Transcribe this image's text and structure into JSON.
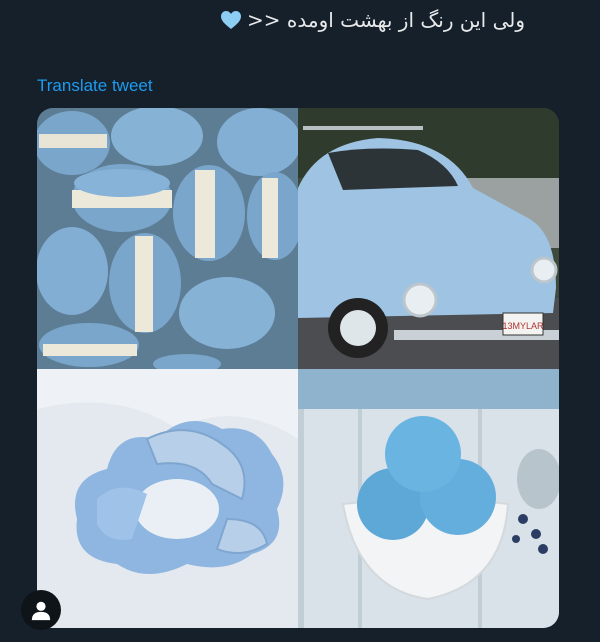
{
  "tweet": {
    "text": "ولی این رنگ از بهشت اومده <<",
    "emoji": "light-blue-heart-icon"
  },
  "translate_link": "Translate tweet",
  "media": {
    "images": [
      "macarons-photo",
      "beetle-car-photo",
      "scrunchie-photo",
      "ice-cream-photo"
    ],
    "car_plate": "13MYLAR"
  },
  "colors": {
    "background": "#15202b",
    "link": "#1d9bf0",
    "accent_blue": "#8fb8de"
  }
}
